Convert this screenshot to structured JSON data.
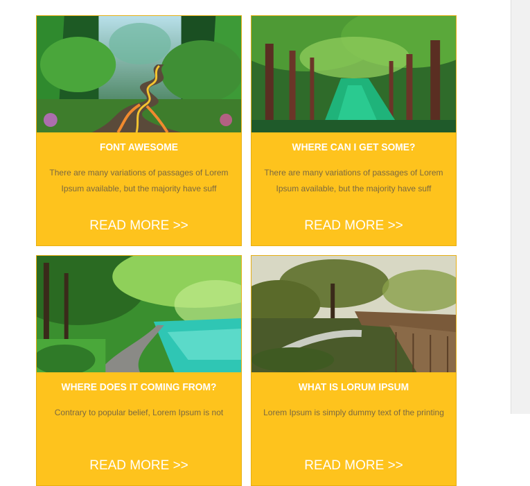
{
  "cards": [
    {
      "image": "winding-road-forest",
      "title": "FONT AWESOME",
      "text": "There are many variations of passages of Lorem Ipsum available, but the majority have suff",
      "link": "READ MORE >>"
    },
    {
      "image": "forest-river",
      "title": "WHERE CAN I GET SOME?",
      "text": "There are many variations of passages of Lorem Ipsum available, but the majority have suff",
      "link": "READ MORE >>"
    },
    {
      "image": "lakeside-path",
      "title": "WHERE DOES IT COMING FROM?",
      "text": "Contrary to popular belief, Lorem Ipsum is not",
      "link": "READ MORE >>"
    },
    {
      "image": "garden-boardwalk",
      "title": "WHAT IS LORUM IPSUM",
      "text": "Lorem Ipsum is simply dummy text of the printing",
      "link": "READ MORE >>"
    }
  ],
  "colors": {
    "card_bg": "#fec31d",
    "title": "#ffffff",
    "text": "#7a6840"
  }
}
